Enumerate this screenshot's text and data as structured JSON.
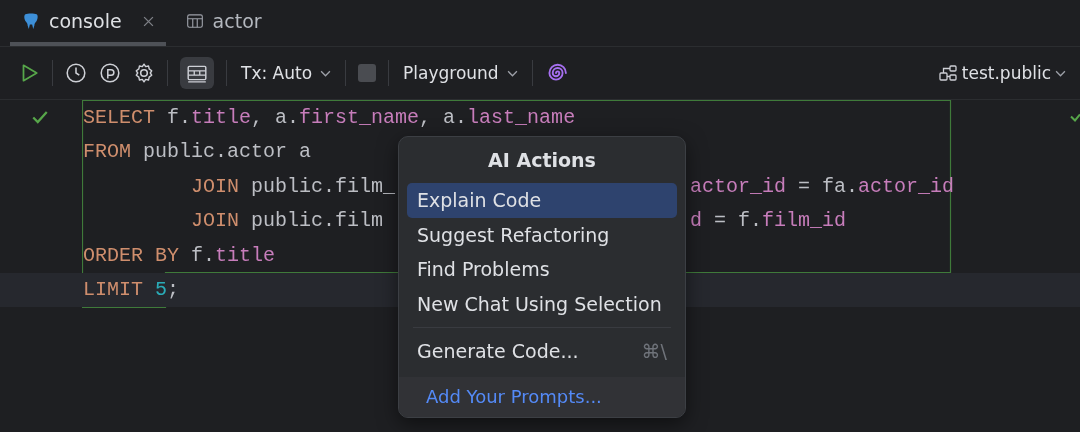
{
  "tabs": [
    {
      "label": "console",
      "kind": "console",
      "selected": true,
      "closable": true
    },
    {
      "label": "actor",
      "kind": "table",
      "selected": false,
      "closable": false
    }
  ],
  "toolbar": {
    "grid_toggle_on": true,
    "stop_disabled": true,
    "tx": "Tx: Auto",
    "mode": "Playground",
    "schema": "test.public"
  },
  "editor": {
    "lines": [
      {
        "ok": true,
        "current": false,
        "indented": false,
        "tokens": [
          {
            "kind": "kw",
            "t": "SELECT"
          },
          {
            "kind": "plain",
            "t": " f."
          },
          {
            "kind": "field",
            "t": "title"
          },
          {
            "kind": "plain",
            "t": ", a."
          },
          {
            "kind": "field",
            "t": "first_name"
          },
          {
            "kind": "plain",
            "t": ", a."
          },
          {
            "kind": "field",
            "t": "last_name"
          }
        ]
      },
      {
        "ok": false,
        "current": false,
        "indented": false,
        "tokens": [
          {
            "kind": "kw",
            "t": "FROM"
          },
          {
            "kind": "plain",
            "t": " public.actor a"
          }
        ]
      },
      {
        "ok": false,
        "current": false,
        "indented": true,
        "tokens": [
          {
            "kind": "kw",
            "t": "JOIN"
          },
          {
            "kind": "plain",
            "t": " public.film_"
          }
        ],
        "tail": [
          {
            "kind": "field",
            "t": "actor_id"
          },
          {
            "kind": "plain",
            "t": " = fa."
          },
          {
            "kind": "field",
            "t": "actor_id"
          }
        ]
      },
      {
        "ok": false,
        "current": false,
        "indented": true,
        "tokens": [
          {
            "kind": "kw",
            "t": "JOIN"
          },
          {
            "kind": "plain",
            "t": " public.film"
          }
        ],
        "tail": [
          {
            "kind": "field",
            "t": "d"
          },
          {
            "kind": "plain",
            "t": " = f."
          },
          {
            "kind": "field",
            "t": "film_id"
          }
        ]
      },
      {
        "ok": false,
        "current": false,
        "indented": false,
        "tokens": [
          {
            "kind": "kw",
            "t": "ORDER BY"
          },
          {
            "kind": "plain",
            "t": " f."
          },
          {
            "kind": "field",
            "t": "title"
          }
        ]
      },
      {
        "ok": false,
        "current": true,
        "indented": false,
        "tokens": [
          {
            "kind": "kw",
            "t": "LIMIT"
          },
          {
            "kind": "num",
            "t": " 5"
          },
          {
            "kind": "plain",
            "t": ";"
          }
        ]
      }
    ],
    "right_check": true
  },
  "ai_menu": {
    "title": "AI Actions",
    "items": [
      {
        "label": "Explain Code",
        "selected": true
      },
      {
        "label": "Suggest Refactoring",
        "selected": false
      },
      {
        "label": "Find Problems",
        "selected": false
      },
      {
        "label": "New Chat Using Selection",
        "selected": false
      }
    ],
    "extra_items": [
      {
        "label": "Generate Code...",
        "shortcut": "⌘\\",
        "selected": false
      }
    ],
    "footer_link": "Add Your Prompts..."
  }
}
